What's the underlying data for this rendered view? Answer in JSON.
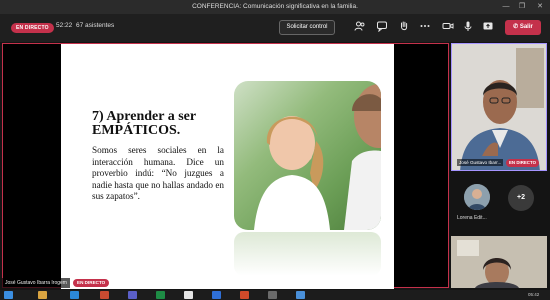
{
  "window": {
    "title": "CONFERENCIA: Comunicación significativa en la familia.",
    "controls": [
      "—",
      "❐",
      "✕"
    ]
  },
  "toolbar": {
    "live_badge": "EN DIRECTO",
    "time": "52:22",
    "attendees": "67 asistentes",
    "request_control": "Solicitar control",
    "leave": "Salir",
    "icons": [
      "people-icon",
      "chat-icon",
      "hand-icon",
      "more-icon",
      "camera-icon",
      "mic-icon",
      "share-icon"
    ]
  },
  "slide": {
    "title": "7) Aprender a ser EMPÁTICOS.",
    "body": "Somos seres sociales en la interacción humana. Dice un proverbio indú: “No juzgues a nadie hasta que no hallas andado en sus zapatos”."
  },
  "presenter": {
    "name": "José Gustavo Ibarra Irogem",
    "live": "EN DIRECTO"
  },
  "participants": {
    "main_tile_name": "José Gustavo Ibarr...",
    "main_tile_live": "EN DIRECTO",
    "avatar_name": "Lorena Edit...",
    "more": "+2"
  },
  "colors": {
    "live_red": "#c4314b",
    "active_speaker": "#a594ff",
    "background": "#141414"
  },
  "taskbar": {
    "clock": "05:42"
  }
}
